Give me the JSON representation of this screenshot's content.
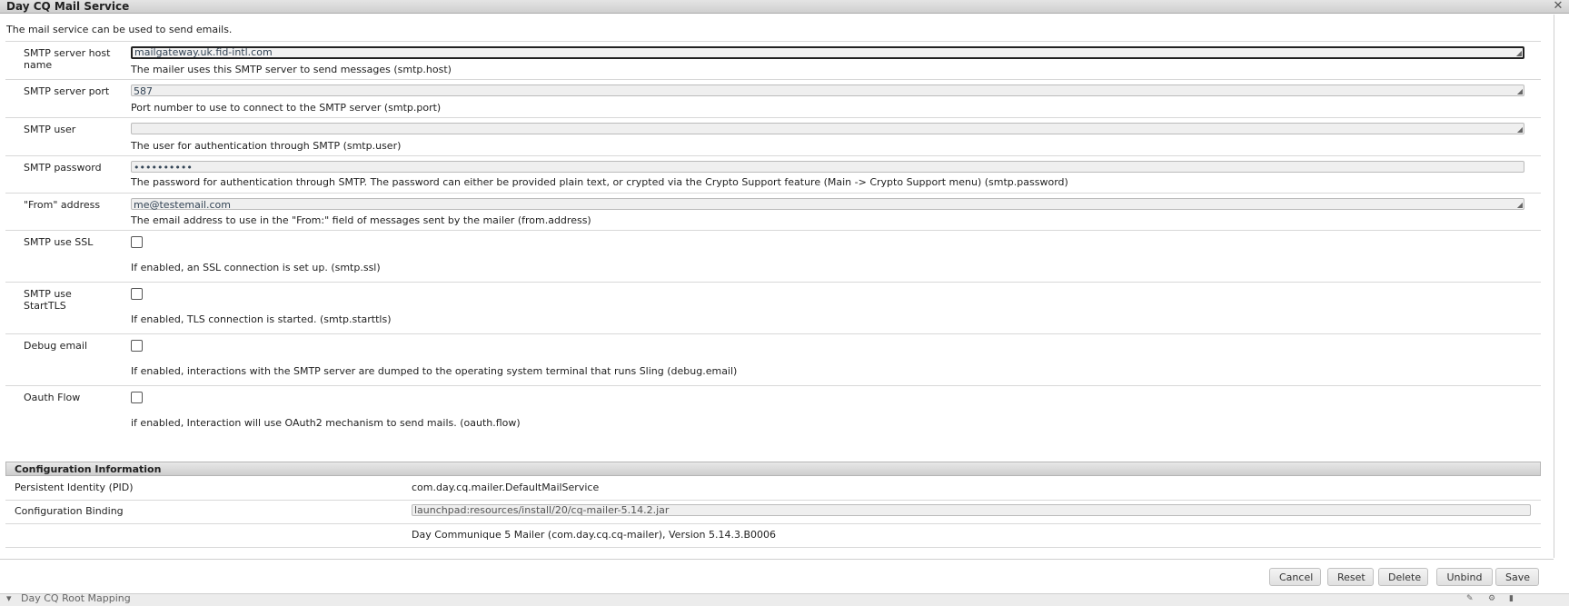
{
  "dialog": {
    "title": "Day CQ Mail Service",
    "description": "The mail service can be used to send emails."
  },
  "properties": [
    {
      "label": "SMTP server host name",
      "type": "text",
      "value": "mailgateway.uk.fid-intl.com",
      "help": "The mailer uses this SMTP server to send messages (smtp.host)"
    },
    {
      "label": "SMTP server port",
      "type": "text",
      "value": "587",
      "help": "Port number to use to connect to the SMTP server (smtp.port)"
    },
    {
      "label": "SMTP user",
      "type": "text",
      "value": "",
      "help": "The user for authentication through SMTP (smtp.user)"
    },
    {
      "label": "SMTP password",
      "type": "password",
      "value": "••••••••••",
      "help": "The password for authentication through SMTP. The password can either be provided plain text, or crypted via the Crypto Support feature (Main -> Crypto Support menu) (smtp.password)"
    },
    {
      "label": "\"From\" address",
      "type": "text",
      "value": "me@testemail.com",
      "help": "The email address to use in the \"From:\" field of messages sent by the mailer (from.address)"
    },
    {
      "label": "SMTP use SSL",
      "type": "checkbox",
      "checked": false,
      "help": "If enabled, an SSL connection is set up. (smtp.ssl)"
    },
    {
      "label": "SMTP use StartTLS",
      "type": "checkbox",
      "checked": false,
      "help": "If enabled, TLS connection is started. (smtp.starttls)"
    },
    {
      "label": "Debug email",
      "type": "checkbox",
      "checked": false,
      "help": "If enabled, interactions with the SMTP server are dumped to the operating system terminal that runs Sling (debug.email)"
    },
    {
      "label": "Oauth Flow",
      "type": "checkbox",
      "checked": false,
      "help": "if enabled, Interaction will use OAuth2 mechanism to send mails. (oauth.flow)"
    }
  ],
  "config_info": {
    "header": "Configuration Information",
    "pid_label": "Persistent Identity (PID)",
    "pid_value": "com.day.cq.mailer.DefaultMailService",
    "binding_label": "Configuration Binding",
    "binding_value": "launchpad:resources/install/20/cq-mailer-5.14.2.jar",
    "bundle_value": "Day Communique 5 Mailer (com.day.cq.cq-mailer), Version 5.14.3.B0006"
  },
  "buttons": {
    "cancel": "Cancel",
    "reset": "Reset",
    "delete": "Delete",
    "unbind": "Unbind",
    "save": "Save"
  },
  "background_row": {
    "label": "Day CQ Root Mapping"
  },
  "icons": {
    "close": "close-icon",
    "expand": "triangle-down-icon",
    "edit": "pencil-icon",
    "config": "gear-icon",
    "delete": "trash-icon"
  }
}
